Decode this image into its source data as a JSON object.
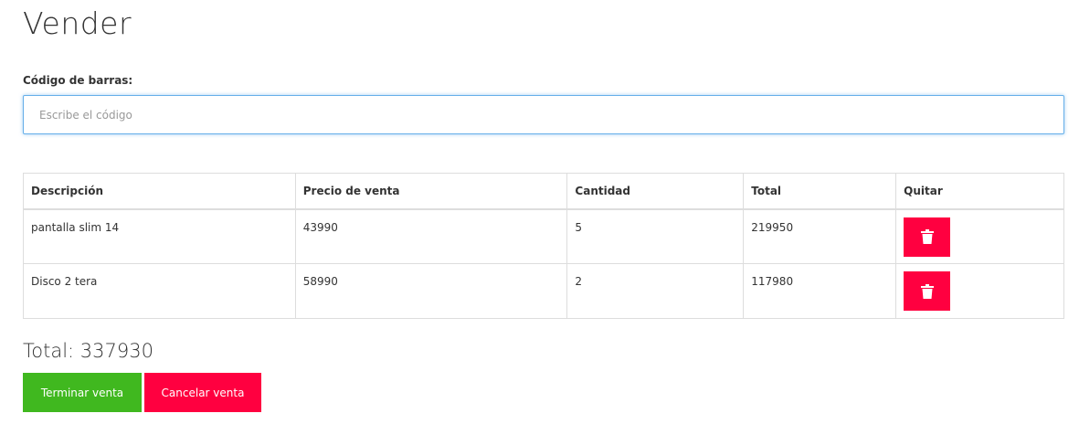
{
  "page": {
    "title": "Vender"
  },
  "barcode": {
    "label": "Código de barras:",
    "placeholder": "Escribe el código",
    "value": ""
  },
  "table": {
    "headers": [
      "Descripción",
      "Precio de venta",
      "Cantidad",
      "Total",
      "Quitar"
    ],
    "rows": [
      {
        "description": "pantalla slim 14",
        "price": "43990",
        "quantity": "5",
        "total": "219950",
        "remove_icon": "trash-icon"
      },
      {
        "description": "Disco 2 tera",
        "price": "58990",
        "quantity": "2",
        "total": "117980",
        "remove_icon": "trash-icon"
      }
    ]
  },
  "summary": {
    "total_text": "Total: 337930"
  },
  "actions": {
    "finish_label": "Terminar venta",
    "cancel_label": "Cancelar venta"
  },
  "colors": {
    "finish": "#40b81f",
    "danger": "#ff0040",
    "focus_border": "#66afe9"
  }
}
